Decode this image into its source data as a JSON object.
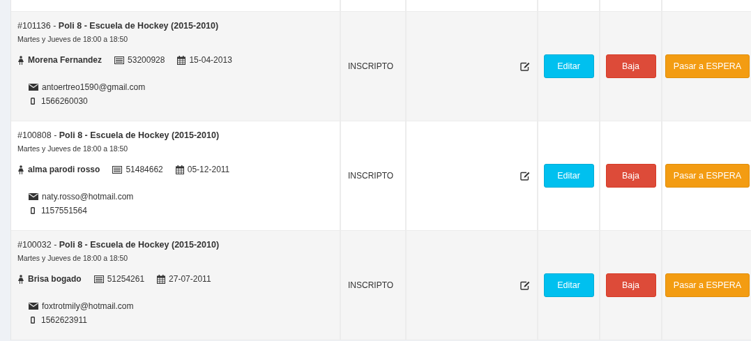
{
  "rows": [
    {
      "title": "#101136 - **Poli 8 - Escuela de Hockey (2015-2010)**",
      "schedule": "Martes y Jueves de 18:00 a 18:50",
      "name": "Morena Fernandez",
      "document": "53200928",
      "birthdate": "15-04-2013",
      "email": "antoertreo1590@gmail.com",
      "phone": "1566260030",
      "status": "INSCRIPTO",
      "actions": [
        {
          "label": "Editar",
          "kind": "edit"
        },
        {
          "label": "Baja",
          "kind": "remove"
        },
        {
          "label": "Pasar a ESPERA",
          "kind": "wait"
        }
      ]
    },
    {
      "title": "#100808 - **Poli 8 - Escuela de Hockey (2015-2010)**",
      "schedule": "Martes y Jueves de 18:00 a 18:50",
      "name": "alma parodi rosso",
      "document": "51484662",
      "birthdate": "05-12-2011",
      "email": "naty.rosso@hotmail.com",
      "phone": "1157551564",
      "status": "INSCRIPTO",
      "actions": [
        {
          "label": "Editar",
          "kind": "edit"
        },
        {
          "label": "Baja",
          "kind": "remove"
        },
        {
          "label": "Pasar a ESPERA",
          "kind": "wait"
        }
      ]
    },
    {
      "title": "#100032 - **Poli 8 - Escuela de Hockey (2015-2010)**",
      "schedule": "Martes y Jueves de 18:00 a 18:50",
      "name": "Brisa bogado",
      "document": "51254261",
      "birthdate": "27-07-2011",
      "email": "foxtrotmily@hotmail.com",
      "phone": "1562623911",
      "status": "INSCRIPTO",
      "actions": [
        {
          "label": "Editar",
          "kind": "edit"
        },
        {
          "label": "Baja",
          "kind": "remove"
        },
        {
          "label": "Pasar a ESPERA",
          "kind": "wait"
        }
      ]
    }
  ]
}
